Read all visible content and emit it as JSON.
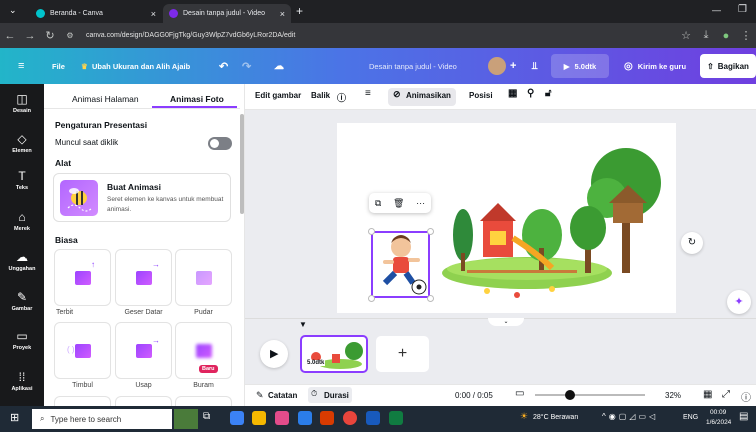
{
  "browser": {
    "tabs": [
      {
        "title": "Beranda - Canva"
      },
      {
        "title": "Desain tanpa judul - Video"
      }
    ],
    "url": "canva.com/design/DAGG0FjgTkg/Guy3WlpZ7vdGb6yLRor2DA/edit"
  },
  "header": {
    "file": "File",
    "resize": "Ubah Ukuran dan Alih Ajaib",
    "doc_title": "Desain tanpa judul - Video",
    "duration": "5.0dtk",
    "send": "Kirim ke guru",
    "share": "Bagikan"
  },
  "sidebar": {
    "items": [
      {
        "label": "Desain",
        "icon": "layout-icon"
      },
      {
        "label": "Elemen",
        "icon": "shapes-icon"
      },
      {
        "label": "Teks",
        "icon": "text-icon"
      },
      {
        "label": "Merek",
        "icon": "brand-icon"
      },
      {
        "label": "Unggahan",
        "icon": "cloud-upload-icon"
      },
      {
        "label": "Gambar",
        "icon": "draw-icon"
      },
      {
        "label": "Proyek",
        "icon": "folder-icon"
      },
      {
        "label": "Aplikasi",
        "icon": "apps-icon"
      }
    ]
  },
  "panel": {
    "tab_page": "Animasi Halaman",
    "tab_photo": "Animasi Foto",
    "presentation": "Pengaturan Presentasi",
    "appear_on_click": "Muncul saat diklik",
    "tools": "Alat",
    "create_title": "Buat Animasi",
    "create_desc": "Seret elemen ke kanvas untuk membuat animasi.",
    "basic": "Biasa",
    "tiles": [
      {
        "label": "Terbit"
      },
      {
        "label": "Geser Datar"
      },
      {
        "label": "Pudar"
      },
      {
        "label": "Timbul"
      },
      {
        "label": "Usap"
      },
      {
        "label": "Buram"
      }
    ],
    "new_badge": "Baru"
  },
  "toolbar": {
    "edit_image": "Edit gambar",
    "flip": "Balik",
    "animate": "Animasikan",
    "position": "Posisi"
  },
  "timeline": {
    "thumb_label": "5.0dtk"
  },
  "footer": {
    "notes": "Catatan",
    "duration": "Durasi",
    "time": "0:00 / 0:05",
    "zoom": "32%",
    "progress": 0.0
  },
  "taskbar": {
    "search_placeholder": "Type here to search",
    "weather": "28°C Berawan",
    "lang": "ENG",
    "time": "00:09",
    "date": "1/6/2024"
  },
  "colors": {
    "accent": "#8b3dff",
    "header_start": "#22b5c9",
    "header_end": "#6f3fe0"
  }
}
